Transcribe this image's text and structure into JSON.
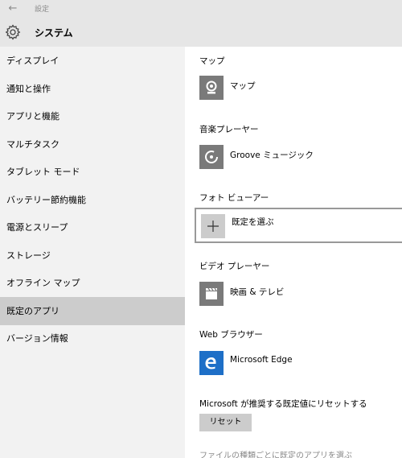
{
  "window": {
    "title": "設定",
    "back_glyph": "←"
  },
  "header": {
    "title": "システム",
    "icon": "gear-icon"
  },
  "sidebar": {
    "items": [
      {
        "label": "ディスプレイ"
      },
      {
        "label": "通知と操作"
      },
      {
        "label": "アプリと機能"
      },
      {
        "label": "マルチタスク"
      },
      {
        "label": "タブレット モード"
      },
      {
        "label": "バッテリー節約機能"
      },
      {
        "label": "電源とスリープ"
      },
      {
        "label": "ストレージ"
      },
      {
        "label": "オフライン マップ"
      },
      {
        "label": "既定のアプリ",
        "selected": true
      },
      {
        "label": "バージョン情報"
      }
    ]
  },
  "sections": [
    {
      "title": "マップ",
      "app": "マップ",
      "icon": "maps-icon"
    },
    {
      "title": "音楽プレーヤー",
      "app": "Groove ミュージック",
      "icon": "groove-music-icon"
    },
    {
      "title": "フォト ビューアー",
      "app": "既定を選ぶ",
      "icon": "plus-icon"
    },
    {
      "title": "ビデオ プレーヤー",
      "app": "映画 & テレビ",
      "icon": "movies-tv-icon"
    },
    {
      "title": "Web ブラウザー",
      "app": "Microsoft Edge",
      "icon": "edge-icon"
    }
  ],
  "reset": {
    "heading": "Microsoft が推奨する既定値にリセットする",
    "button": "リセット"
  },
  "footer_link": "ファイルの種類ごとに既定のアプリを選ぶ",
  "colors": {
    "tile_gray": "#7a7a7a",
    "edge_blue": "#1e6fc7",
    "selected_bg": "#cccccc",
    "sidebar_bg": "#f2f2f2"
  }
}
